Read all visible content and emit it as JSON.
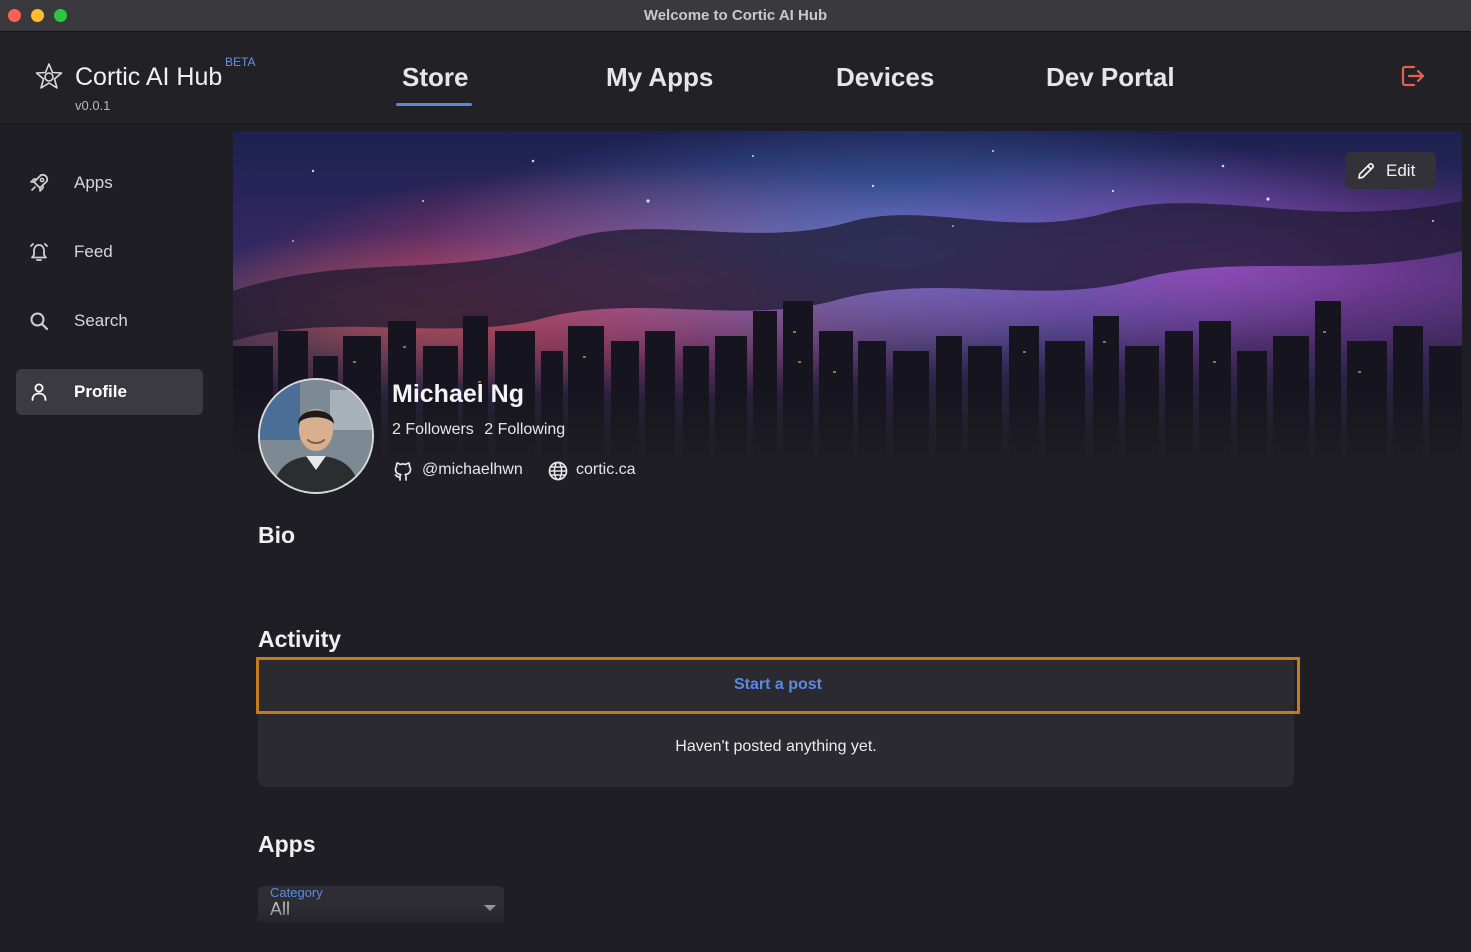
{
  "window": {
    "title": "Welcome to Cortic AI Hub"
  },
  "header": {
    "app_name": "Cortic AI Hub",
    "beta_badge": "BETA",
    "version": "v0.0.1",
    "nav": {
      "store": "Store",
      "my_apps": "My Apps",
      "devices": "Devices",
      "dev_portal": "Dev Portal"
    },
    "active_nav": "Store",
    "logout_icon": "logout-icon"
  },
  "sidebar": {
    "items": [
      {
        "label": "Apps",
        "icon": "rocket-icon"
      },
      {
        "label": "Feed",
        "icon": "bell-icon"
      },
      {
        "label": "Search",
        "icon": "search-icon"
      },
      {
        "label": "Profile",
        "icon": "user-icon",
        "active": true
      }
    ]
  },
  "profile": {
    "edit_label": "Edit",
    "name": "Michael Ng",
    "followers": "2 Followers",
    "following": "2 Following",
    "github": "@michaelhwn",
    "website": "cortic.ca"
  },
  "sections": {
    "bio": "Bio",
    "activity": "Activity",
    "apps": "Apps"
  },
  "activity": {
    "start_post": "Start a post",
    "empty": "Haven't posted anything yet."
  },
  "apps_filter": {
    "label": "Category",
    "value": "All"
  },
  "colors": {
    "accent": "#5d86e0",
    "highlight_border": "#c57a1c",
    "logout": "#e2624b",
    "background": "#1f1e24"
  }
}
